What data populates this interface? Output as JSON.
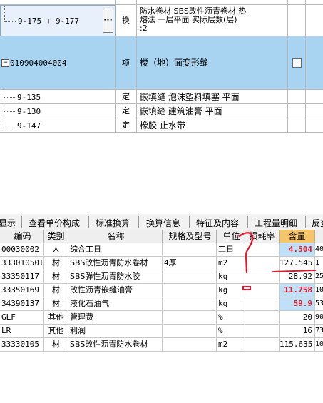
{
  "upper_rows": [
    {
      "code": "9-175 + 9-177",
      "type": "换",
      "name_lines": [
        "防水卷材 SBS改性沥青卷材 热",
        "熔法 一层平面 实际层数(层)",
        ":2"
      ],
      "more": "···"
    },
    {
      "code": "010904004004",
      "expander": "−",
      "type": "项",
      "name": "楼（地）面变形缝"
    },
    {
      "code": "9-135",
      "type": "定",
      "name": "嵌填缝 泡沫塑料填塞 平面"
    },
    {
      "code": "9-130",
      "type": "定",
      "name": "嵌填缝 建筑油膏 平面"
    },
    {
      "code": "9-147",
      "type": "定",
      "name": "橡胶 止水带"
    }
  ],
  "tabs": [
    "显示",
    "查看单价构成",
    "标准换算",
    "换算信息",
    "特征及内容",
    "工程量明细",
    "反查"
  ],
  "columns": {
    "code": "编码",
    "type": "类别",
    "name": "名称",
    "spec": "规格及型号",
    "unit": "单位",
    "loss": "损耗率",
    "qty": "含量"
  },
  "rows": [
    {
      "code": "00030002",
      "type": "人",
      "name": "综合工日",
      "spec": "",
      "unit": "工日",
      "qty": "4.504",
      "more": "40",
      "qty_style": "red"
    },
    {
      "code": "33301050l",
      "type": "材",
      "name": "SBS改性沥青防水卷材",
      "spec": "4厚",
      "unit": "m2",
      "qty": "127.545",
      "more": "1",
      "qty_style": "normal"
    },
    {
      "code": "33350117",
      "type": "材",
      "name": "SBS弹性沥青防水胶",
      "spec": "",
      "unit": "kg",
      "qty": "28.92",
      "more": "25",
      "qty_style": "normal"
    },
    {
      "code": "33350169",
      "type": "材",
      "name": "改性沥青嵌缝油膏",
      "spec": "",
      "unit": "kg",
      "qty": "11.758",
      "more": "10",
      "qty_style": "red"
    },
    {
      "code": "34390137",
      "type": "材",
      "name": "液化石油气",
      "spec": "",
      "unit": "kg",
      "qty": "59.9",
      "more": "53",
      "qty_style": "red"
    },
    {
      "code": "GLF",
      "type": "其他",
      "name": "管理费",
      "spec": "",
      "unit": "%",
      "qty": "20",
      "more": "90",
      "qty_style": "normal"
    },
    {
      "code": "LR",
      "type": "其他",
      "name": "利润",
      "spec": "",
      "unit": "%",
      "qty": "16",
      "more": "73",
      "qty_style": "normal"
    },
    {
      "code": "33330105",
      "type": "材",
      "name": "SBS改性沥青防水卷材",
      "spec": "",
      "unit": "m2",
      "qty": "115.635",
      "more": "10",
      "qty_style": "normal"
    }
  ],
  "colors": {
    "selected_row": "#a8d4f2",
    "edit_cell": "#e8f1fb",
    "qty_highlight": "#bfe0f6",
    "qty_red": "#e0202e",
    "annotation": "#e8142b"
  }
}
